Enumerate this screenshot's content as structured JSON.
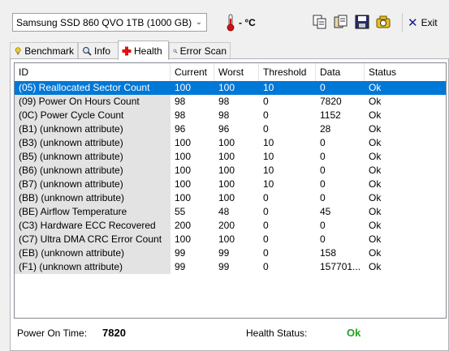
{
  "toolbar": {
    "drive": "Samsung SSD 860 QVO 1TB (1000 GB)",
    "temperature": "- °C",
    "exit_label": "Exit"
  },
  "tabs": [
    {
      "label": "Benchmark",
      "icon": "lightbulb-icon"
    },
    {
      "label": "Info",
      "icon": "magnifier-icon"
    },
    {
      "label": "Health",
      "icon": "red-cross-icon",
      "active": true
    },
    {
      "label": "Error Scan",
      "icon": "magnifier-icon"
    }
  ],
  "table": {
    "columns": [
      "ID",
      "Current",
      "Worst",
      "Threshold",
      "Data",
      "Status"
    ],
    "rows": [
      [
        "(05) Reallocated Sector Count",
        "100",
        "100",
        "10",
        "0",
        "Ok"
      ],
      [
        "(09) Power On Hours Count",
        "98",
        "98",
        "0",
        "7820",
        "Ok"
      ],
      [
        "(0C) Power Cycle Count",
        "98",
        "98",
        "0",
        "1152",
        "Ok"
      ],
      [
        "(B1) (unknown attribute)",
        "96",
        "96",
        "0",
        "28",
        "Ok"
      ],
      [
        "(B3) (unknown attribute)",
        "100",
        "100",
        "10",
        "0",
        "Ok"
      ],
      [
        "(B5) (unknown attribute)",
        "100",
        "100",
        "10",
        "0",
        "Ok"
      ],
      [
        "(B6) (unknown attribute)",
        "100",
        "100",
        "10",
        "0",
        "Ok"
      ],
      [
        "(B7) (unknown attribute)",
        "100",
        "100",
        "10",
        "0",
        "Ok"
      ],
      [
        "(BB) (unknown attribute)",
        "100",
        "100",
        "0",
        "0",
        "Ok"
      ],
      [
        "(BE) Airflow Temperature",
        "55",
        "48",
        "0",
        "45",
        "Ok"
      ],
      [
        "(C3) Hardware ECC Recovered",
        "200",
        "200",
        "0",
        "0",
        "Ok"
      ],
      [
        "(C7) Ultra DMA CRC Error Count",
        "100",
        "100",
        "0",
        "0",
        "Ok"
      ],
      [
        "(EB) (unknown attribute)",
        "99",
        "99",
        "0",
        "158",
        "Ok"
      ],
      [
        "(F1) (unknown attribute)",
        "99",
        "99",
        "0",
        "157701...",
        "Ok"
      ]
    ],
    "selected_row": 0
  },
  "status": {
    "power_on_label": "Power On Time:",
    "power_on_value": "7820",
    "health_label": "Health Status:",
    "health_value": "Ok",
    "health_color": "#21a121"
  }
}
